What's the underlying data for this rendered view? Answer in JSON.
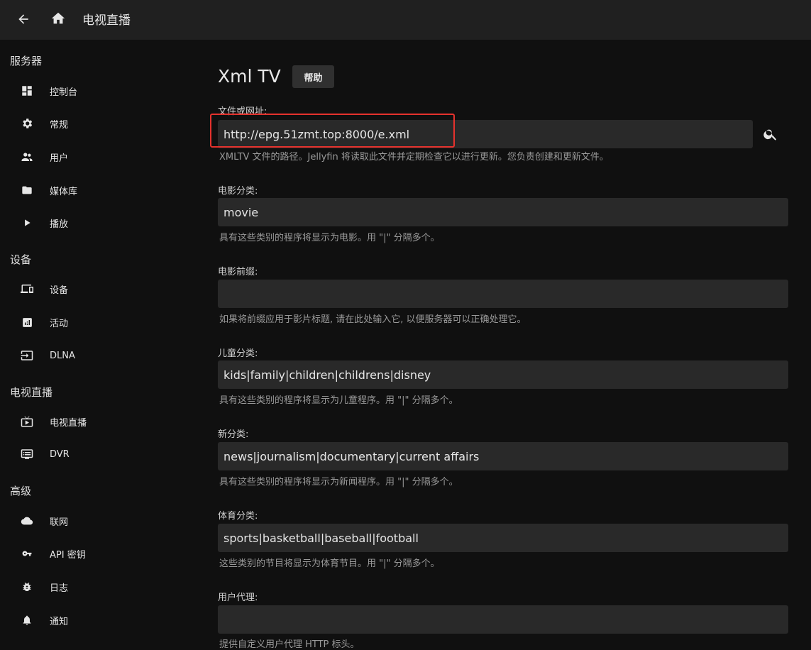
{
  "header": {
    "title": "电视直播"
  },
  "sidebar": {
    "sections": [
      {
        "header": "服务器",
        "items": [
          {
            "label": "控制台",
            "icon": "dashboard-icon"
          },
          {
            "label": "常规",
            "icon": "gear-icon"
          },
          {
            "label": "用户",
            "icon": "people-icon"
          },
          {
            "label": "媒体库",
            "icon": "folder-icon"
          },
          {
            "label": "播放",
            "icon": "play-icon"
          }
        ]
      },
      {
        "header": "设备",
        "items": [
          {
            "label": "设备",
            "icon": "devices-icon"
          },
          {
            "label": "活动",
            "icon": "analytics-icon"
          },
          {
            "label": "DLNA",
            "icon": "input-icon"
          }
        ]
      },
      {
        "header": "电视直播",
        "items": [
          {
            "label": "电视直播",
            "icon": "live-tv-icon"
          },
          {
            "label": "DVR",
            "icon": "dvr-icon"
          }
        ]
      },
      {
        "header": "高级",
        "items": [
          {
            "label": "联网",
            "icon": "cloud-icon"
          },
          {
            "label": "API 密钥",
            "icon": "key-icon"
          },
          {
            "label": "日志",
            "icon": "bug-icon"
          },
          {
            "label": "通知",
            "icon": "bell-icon"
          }
        ]
      }
    ]
  },
  "main": {
    "title": "Xml TV",
    "help_label": "帮助",
    "fields": [
      {
        "label": "文件或网址:",
        "value": "http://epg.51zmt.top:8000/e.xml",
        "help": "XMLTV 文件的路径。Jellyfin 将读取此文件并定期检查它以进行更新。您负责创建和更新文件。"
      },
      {
        "label": "电影分类:",
        "value": "movie",
        "help": "具有这些类别的程序将显示为电影。用 \"|\" 分隔多个。"
      },
      {
        "label": "电影前缀:",
        "value": "",
        "help": "如果将前缀应用于影片标题, 请在此处输入它, 以便服务器可以正确处理它。"
      },
      {
        "label": "儿童分类:",
        "value": "kids|family|children|childrens|disney",
        "help": "具有这些类别的程序将显示为儿童程序。用 \"|\" 分隔多个。"
      },
      {
        "label": "新分类:",
        "value": "news|journalism|documentary|current affairs",
        "help": "具有这些类别的程序将显示为新闻程序。用 \"|\" 分隔多个。"
      },
      {
        "label": "体育分类:",
        "value": "sports|basketball|baseball|football",
        "help": "这些类别的节目将显示为体育节目。用 \"|\" 分隔多个。"
      },
      {
        "label": "用户代理:",
        "value": "",
        "help": "提供自定义用户代理 HTTP 标头。"
      }
    ]
  },
  "colors": {
    "highlight": "#e5322d",
    "input_bg": "#292929",
    "topbar_bg": "#202020"
  }
}
